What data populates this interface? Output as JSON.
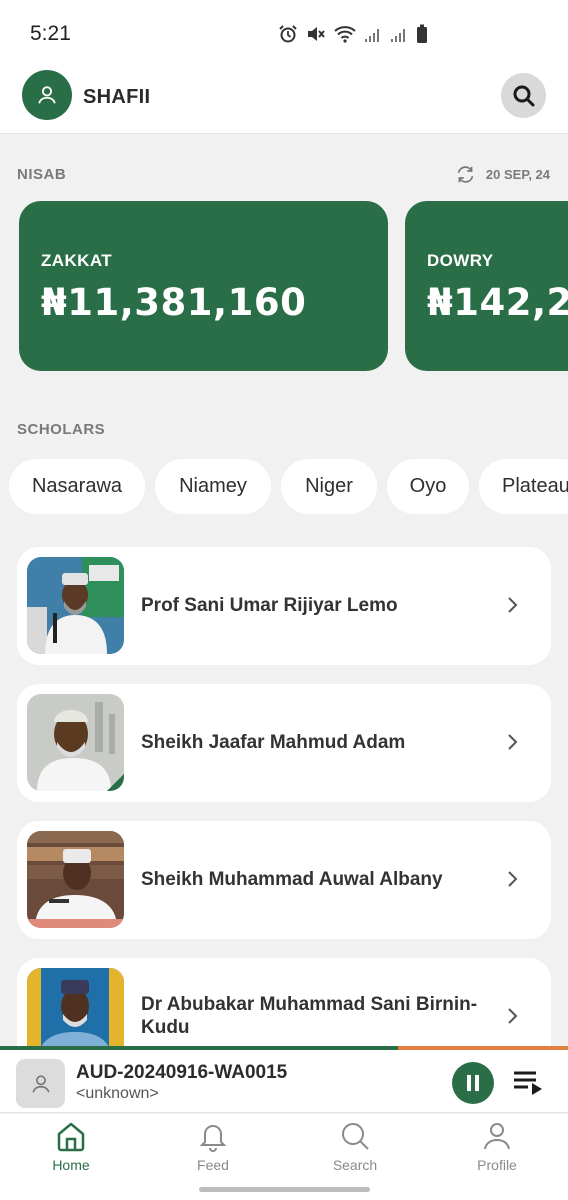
{
  "status_bar": {
    "time": "5:21",
    "icons": [
      "alarm-icon",
      "mute-icon",
      "wifi-icon",
      "signal-icon",
      "signal-icon",
      "battery-icon"
    ]
  },
  "header": {
    "title": "SHAFII",
    "avatar_icon": "user-icon",
    "search_icon": "search-icon"
  },
  "nisab": {
    "label": "NISAB",
    "refresh_icon": "refresh-icon",
    "date": "20 SEP, 24",
    "cards": [
      {
        "label": "ZAKKAT",
        "value": "₦11,381,160"
      },
      {
        "label": "DOWRY",
        "value": "₦142,2"
      }
    ]
  },
  "scholars": {
    "label": "SCHOLARS",
    "filters": [
      "Nasarawa",
      "Niamey",
      "Niger",
      "Oyo",
      "Plateau"
    ],
    "items": [
      {
        "name": "Prof Sani Umar Rijiyar Lemo"
      },
      {
        "name": "Sheikh Jaafar Mahmud Adam"
      },
      {
        "name": "Sheikh Muhammad Auwal Albany"
      },
      {
        "name": "Dr Abubakar Muhammad Sani Birnin-Kudu"
      }
    ]
  },
  "player": {
    "title": "AUD-20240916-WA0015",
    "artist": "<unknown>",
    "progress": 0.7,
    "icons": {
      "thumb": "user-icon",
      "pause": "pause-icon",
      "queue": "playlist-icon"
    }
  },
  "nav": [
    {
      "label": "Home",
      "icon": "home-icon",
      "active": true
    },
    {
      "label": "Feed",
      "icon": "bell-icon",
      "active": false
    },
    {
      "label": "Search",
      "icon": "search-icon",
      "active": false
    },
    {
      "label": "Profile",
      "icon": "user-icon",
      "active": false
    }
  ],
  "colors": {
    "primary": "#2a6e48",
    "progress_remaining": "#e07f3f",
    "background": "#f1f1f1"
  }
}
